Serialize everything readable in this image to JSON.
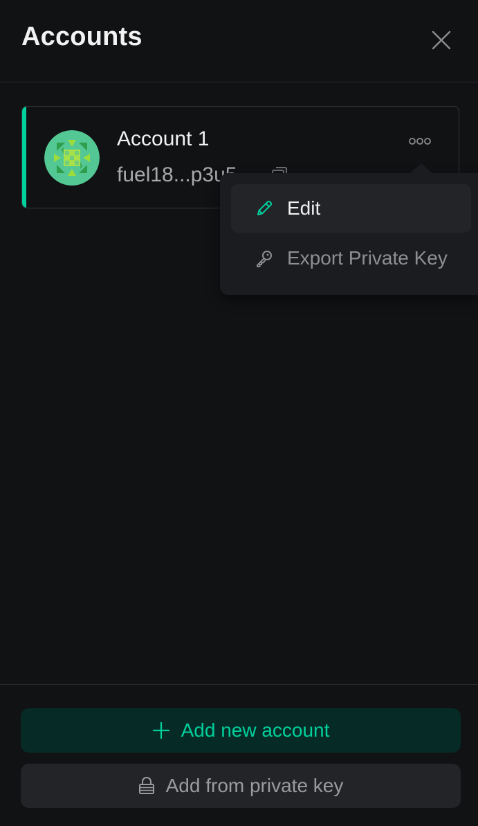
{
  "header": {
    "title": "Accounts",
    "close_icon": "close-icon"
  },
  "accounts": [
    {
      "name": "Account 1",
      "address": "fuel18...p3u5",
      "avatar_icon": "identicon-avatar",
      "selected": true,
      "accent_color": "#00d09c"
    }
  ],
  "account_menu": {
    "items": [
      {
        "label": "Edit",
        "icon": "pencil-icon",
        "color": "#00d09c"
      },
      {
        "label": "Export Private Key",
        "icon": "key-icon"
      }
    ]
  },
  "footer": {
    "add_new_label": "Add new account",
    "add_private_key_label": "Add from private key"
  },
  "colors": {
    "background": "#111214",
    "accent": "#00d09c",
    "primary_button_bg": "#062b26",
    "secondary_button_bg": "#222428"
  }
}
